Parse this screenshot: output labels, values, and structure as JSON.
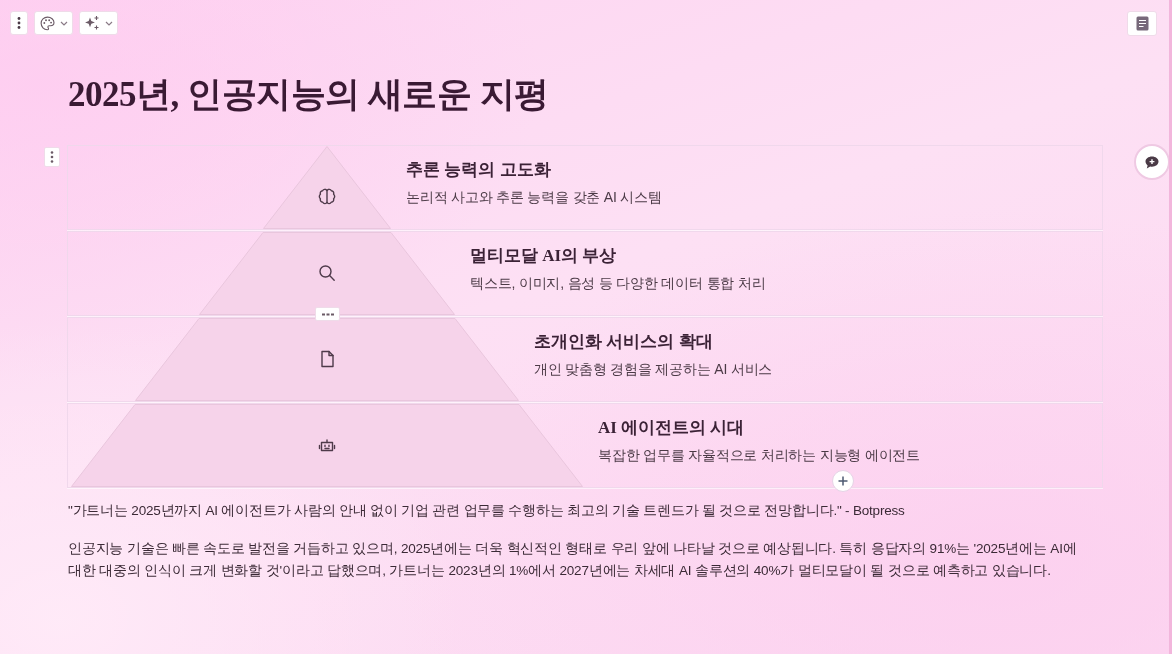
{
  "title": "2025년, 인공지능의 새로운 지평",
  "pyramid": {
    "tiers": [
      {
        "heading": "추론 능력의 고도화",
        "description": "논리적 사고와 추론 능력을 갖춘 AI 시스템"
      },
      {
        "heading": "멀티모달 AI의 부상",
        "description": "텍스트, 이미지, 음성 등 다양한 데이터 통합 처리"
      },
      {
        "heading": "초개인화 서비스의 확대",
        "description": "개인 맞춤형 경험을 제공하는 AI 서비스"
      },
      {
        "heading": "AI 에이전트의 시대",
        "description": "복잡한 업무를 자율적으로 처리하는 지능형 에이전트"
      }
    ]
  },
  "quote": "\"가트너는 2025년까지 AI 에이전트가 사람의 안내 없이 기업 관련 업무를 수행하는 최고의 기술 트렌드가 될 것으로 전망합니다.\" - Botpress",
  "paragraph": "인공지능 기술은 빠른 속도로 발전을 거듭하고 있으며, 2025년에는 더욱 혁신적인 형태로 우리 앞에 나타날 것으로 예상됩니다. 특히 응답자의 91%는 '2025년에는 AI에 대한 대중의 인식이 크게 변화할 것'이라고 답했으며, 가트너는 2023년의 1%에서 2027년에는 차세대 AI 솔루션의 40%가 멀티모달이 될 것으로 예측하고 있습니다."
}
